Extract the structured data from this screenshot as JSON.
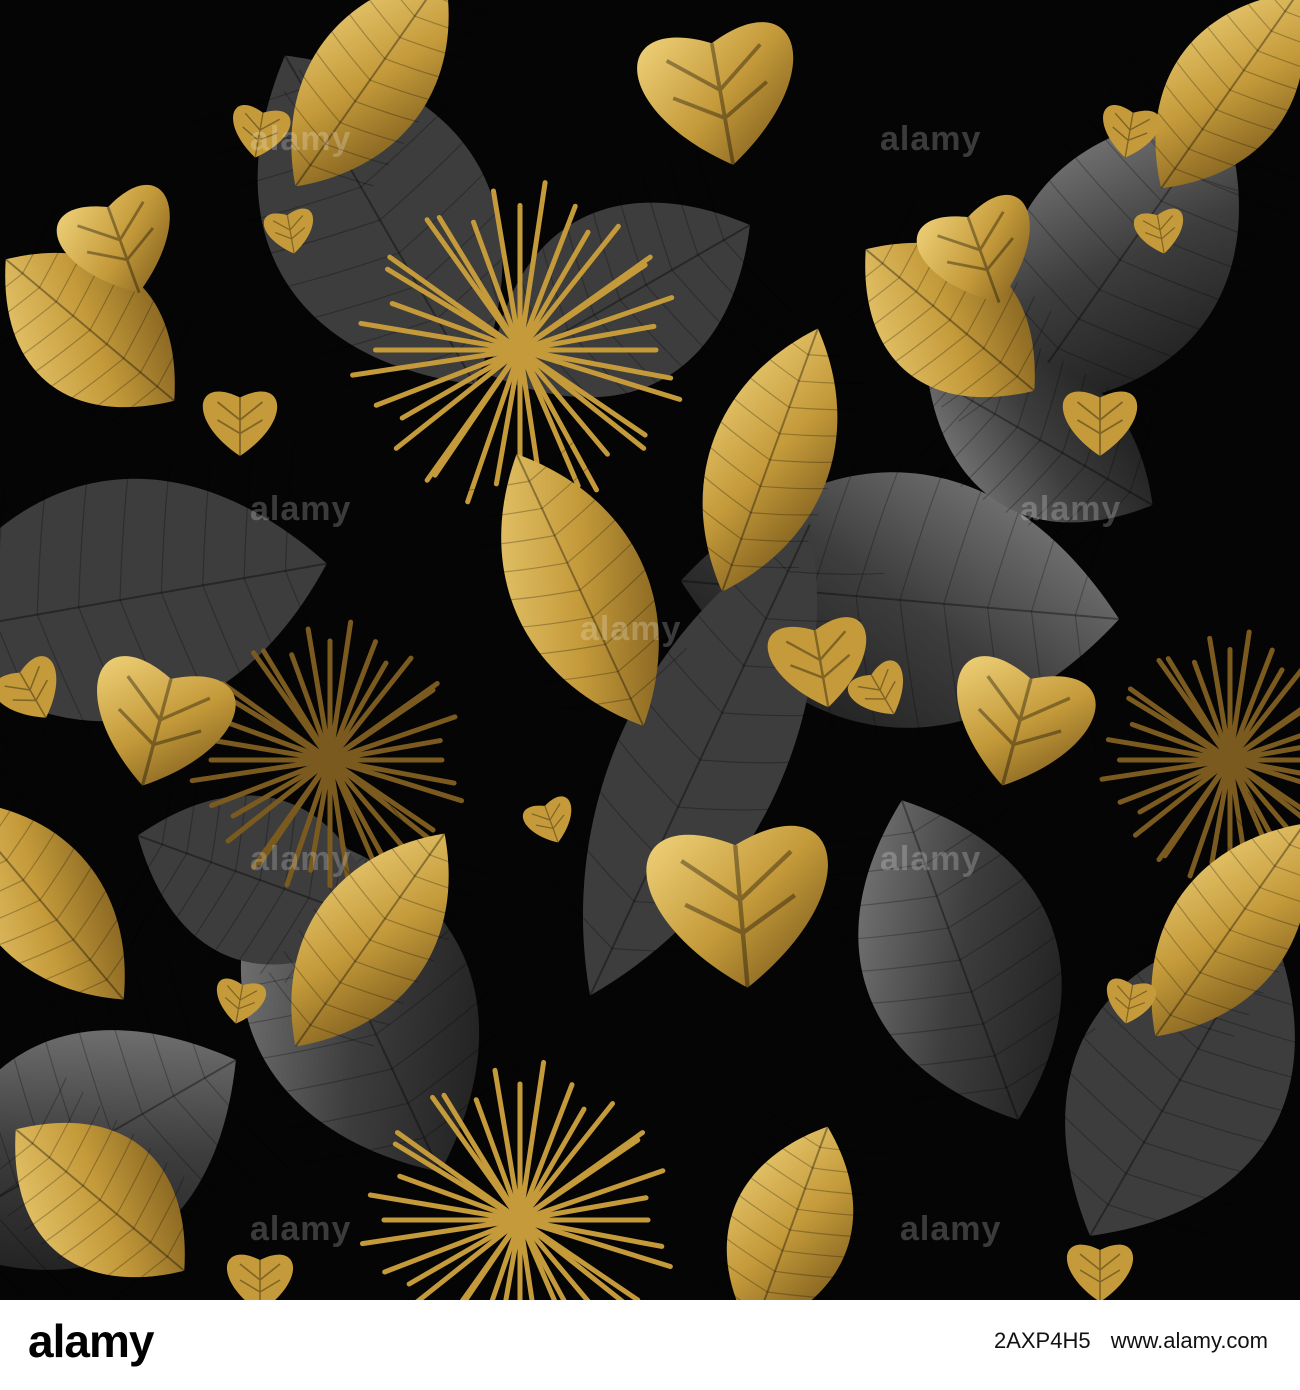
{
  "image": {
    "subject": "seamless tropical leaf pattern",
    "colors": {
      "background": "#050505",
      "gold_light": "#e7c86a",
      "gold": "#c49a3a",
      "gold_dark": "#7a5a1e",
      "gray_light": "#7a7a7a",
      "gray": "#3d3d3d",
      "gray_dark": "#1e1e1e"
    },
    "watermark_text": "alamy"
  },
  "footer": {
    "logo": "alamy",
    "image_id": "2AXP4H5",
    "site": "www.alamy.com"
  }
}
